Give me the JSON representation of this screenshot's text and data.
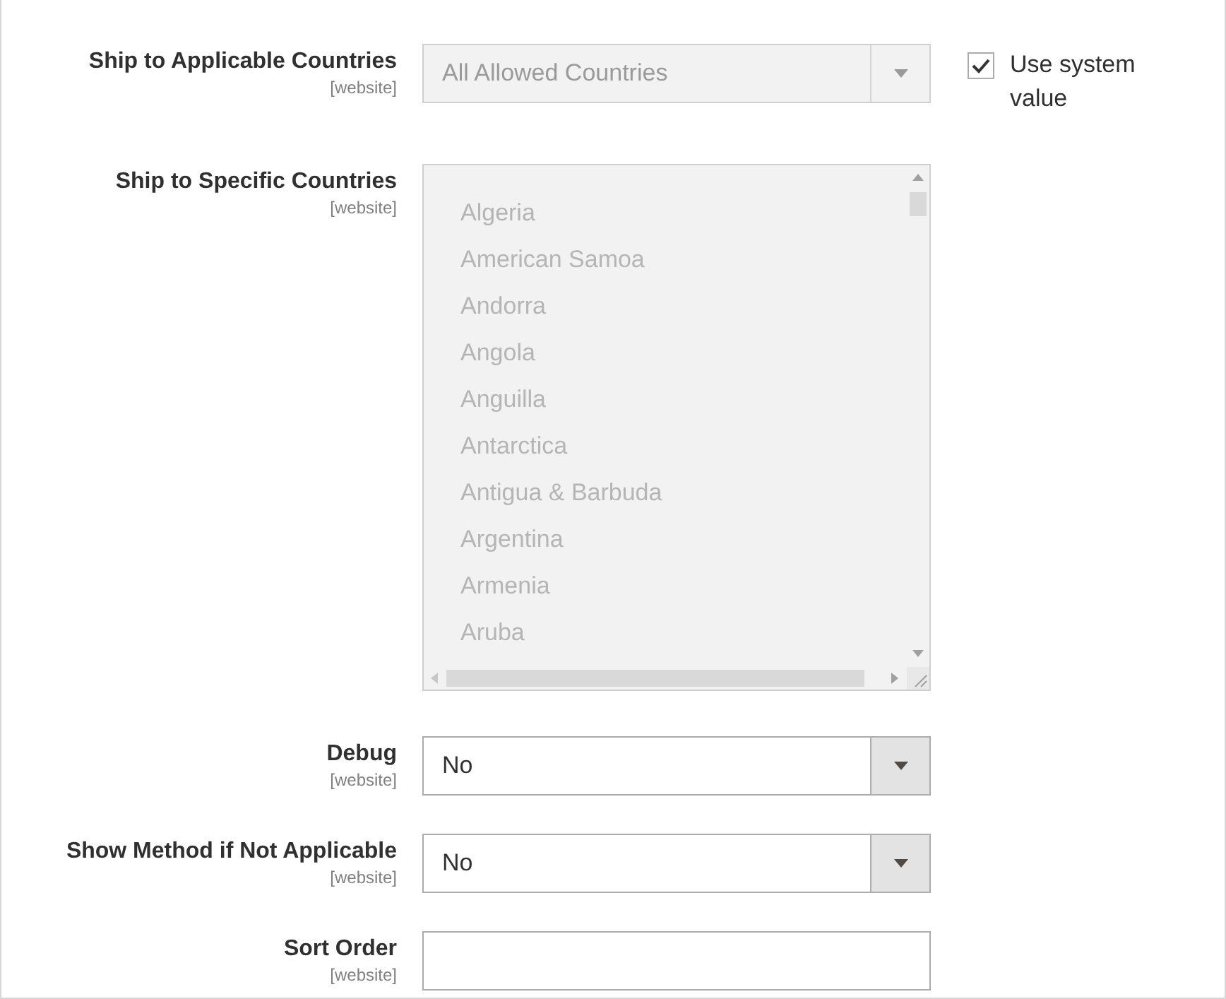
{
  "fields": [
    {
      "kind": "select",
      "label": "Ship to Applicable Countries",
      "scope": "[website]",
      "value": "All Allowed Countries",
      "disabled": true,
      "use_system_value": {
        "label": "Use system value",
        "checked": true
      }
    },
    {
      "kind": "multiselect",
      "label": "Ship to Specific Countries",
      "scope": "[website]",
      "disabled": true,
      "options": [
        "Algeria",
        "American Samoa",
        "Andorra",
        "Angola",
        "Anguilla",
        "Antarctica",
        "Antigua & Barbuda",
        "Argentina",
        "Armenia",
        "Aruba"
      ]
    },
    {
      "kind": "select",
      "label": "Debug",
      "scope": "[website]",
      "value": "No",
      "disabled": false
    },
    {
      "kind": "select",
      "label": "Show Method if Not Applicable",
      "scope": "[website]",
      "value": "No",
      "disabled": false
    },
    {
      "kind": "text",
      "label": "Sort Order",
      "scope": "[website]"
    }
  ]
}
